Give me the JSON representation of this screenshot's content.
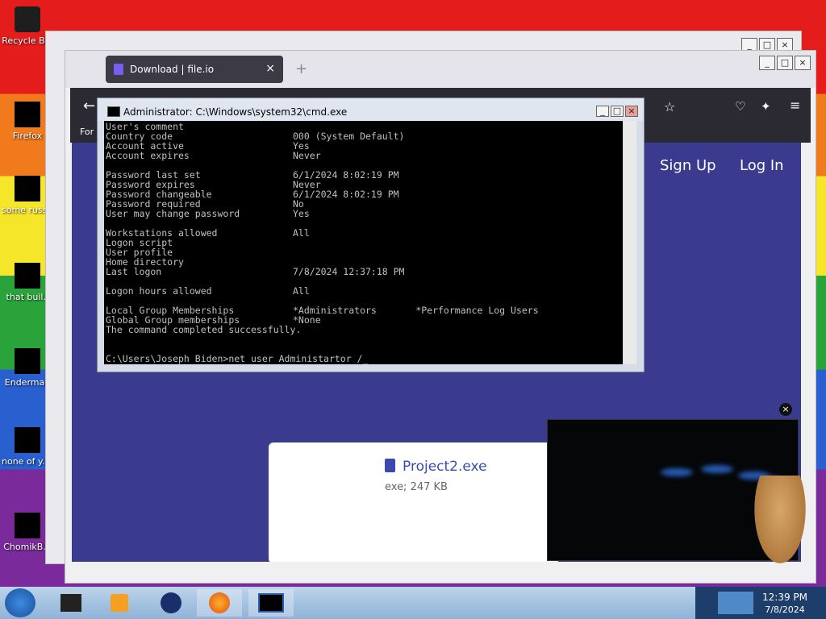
{
  "desktop": {
    "icons": [
      {
        "label": "Recycle Bin",
        "name": "recycle-bin"
      },
      {
        "label": "Firefox",
        "name": "firefox"
      },
      {
        "label": "some russ... ran a ra...",
        "name": "shortcut-1"
      },
      {
        "label": "that buil..",
        "name": "shortcut-2"
      },
      {
        "label": "Enderman",
        "name": "enderman"
      },
      {
        "label": "none of y... retards kn...",
        "name": "shortcut-3"
      },
      {
        "label": "ChomikB...",
        "name": "chomik"
      }
    ]
  },
  "browser": {
    "tab_title": "Download | file.io",
    "new_tab": "+",
    "nav": {
      "signup": "Sign Up",
      "login": "Log In",
      "toolbar_hint": "For"
    },
    "file": {
      "name": "Project2.exe",
      "meta": "exe; 247 KB"
    }
  },
  "cmd": {
    "title": "Administrator: C:\\Windows\\system32\\cmd.exe",
    "lines": [
      {
        "k": "User's comment",
        "v": ""
      },
      {
        "k": "Country code",
        "v": "000 (System Default)"
      },
      {
        "k": "Account active",
        "v": "Yes"
      },
      {
        "k": "Account expires",
        "v": "Never"
      },
      {
        "k": "",
        "v": ""
      },
      {
        "k": "Password last set",
        "v": "6/1/2024 8:02:19 PM"
      },
      {
        "k": "Password expires",
        "v": "Never"
      },
      {
        "k": "Password changeable",
        "v": "6/1/2024 8:02:19 PM"
      },
      {
        "k": "Password required",
        "v": "No"
      },
      {
        "k": "User may change password",
        "v": "Yes"
      },
      {
        "k": "",
        "v": ""
      },
      {
        "k": "Workstations allowed",
        "v": "All"
      },
      {
        "k": "Logon script",
        "v": ""
      },
      {
        "k": "User profile",
        "v": ""
      },
      {
        "k": "Home directory",
        "v": ""
      },
      {
        "k": "Last logon",
        "v": "7/8/2024 12:37:18 PM"
      },
      {
        "k": "",
        "v": ""
      },
      {
        "k": "Logon hours allowed",
        "v": "All"
      },
      {
        "k": "",
        "v": ""
      },
      {
        "k": "Local Group Memberships",
        "v": "*Administrators       *Performance Log Users"
      },
      {
        "k": "Global Group memberships",
        "v": "*None"
      },
      {
        "k": "The command completed successfully.",
        "v": ""
      },
      {
        "k": "",
        "v": ""
      },
      {
        "k": "",
        "v": ""
      },
      {
        "k": "C:\\Users\\Joseph Biden>net user Administartor /_",
        "v": ""
      }
    ]
  },
  "video": {
    "close": "×"
  },
  "window_buttons": {
    "minimize": "_",
    "maximize": "□",
    "close": "×"
  },
  "taskbar": {
    "time": "12:39 PM",
    "date": "7/8/2024"
  }
}
